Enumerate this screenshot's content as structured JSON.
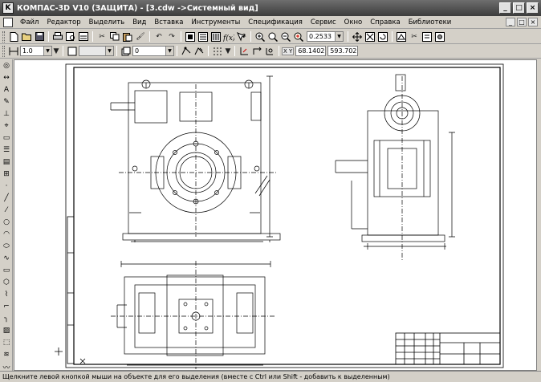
{
  "window": {
    "app_icon": "K",
    "title": "КОМПАС-3D V10 (ЗАЩИТА) - [3.cdw ->Системный вид]",
    "minimize": "_",
    "maximize": "□",
    "close": "×"
  },
  "menu": {
    "items": [
      "Файл",
      "Редактор",
      "Выделить",
      "Вид",
      "Вставка",
      "Инструменты",
      "Спецификация",
      "Сервис",
      "Окно",
      "Справка",
      "Библиотеки"
    ],
    "doc_controls": [
      "_",
      "□",
      "×"
    ]
  },
  "toolbar_main": {
    "zoom_value": "0.2533"
  },
  "toolbar_props": {
    "style_value": "1.0",
    "layer_value": "0",
    "coord_label": "X Y",
    "x_value": "68.1402",
    "y_value": "593.702"
  },
  "status": {
    "text": "Щелкните левой кнопкой мыши на объекте для его выделения (вместе с Ctrl или Shift - добавить к выделенным)"
  },
  "icons": {
    "new": "new-document-icon",
    "open": "open-folder-icon",
    "save": "save-icon",
    "print": "print-icon",
    "zoom_in": "zoom-in-icon",
    "zoom_out": "zoom-out-icon",
    "pan": "pan-icon"
  }
}
